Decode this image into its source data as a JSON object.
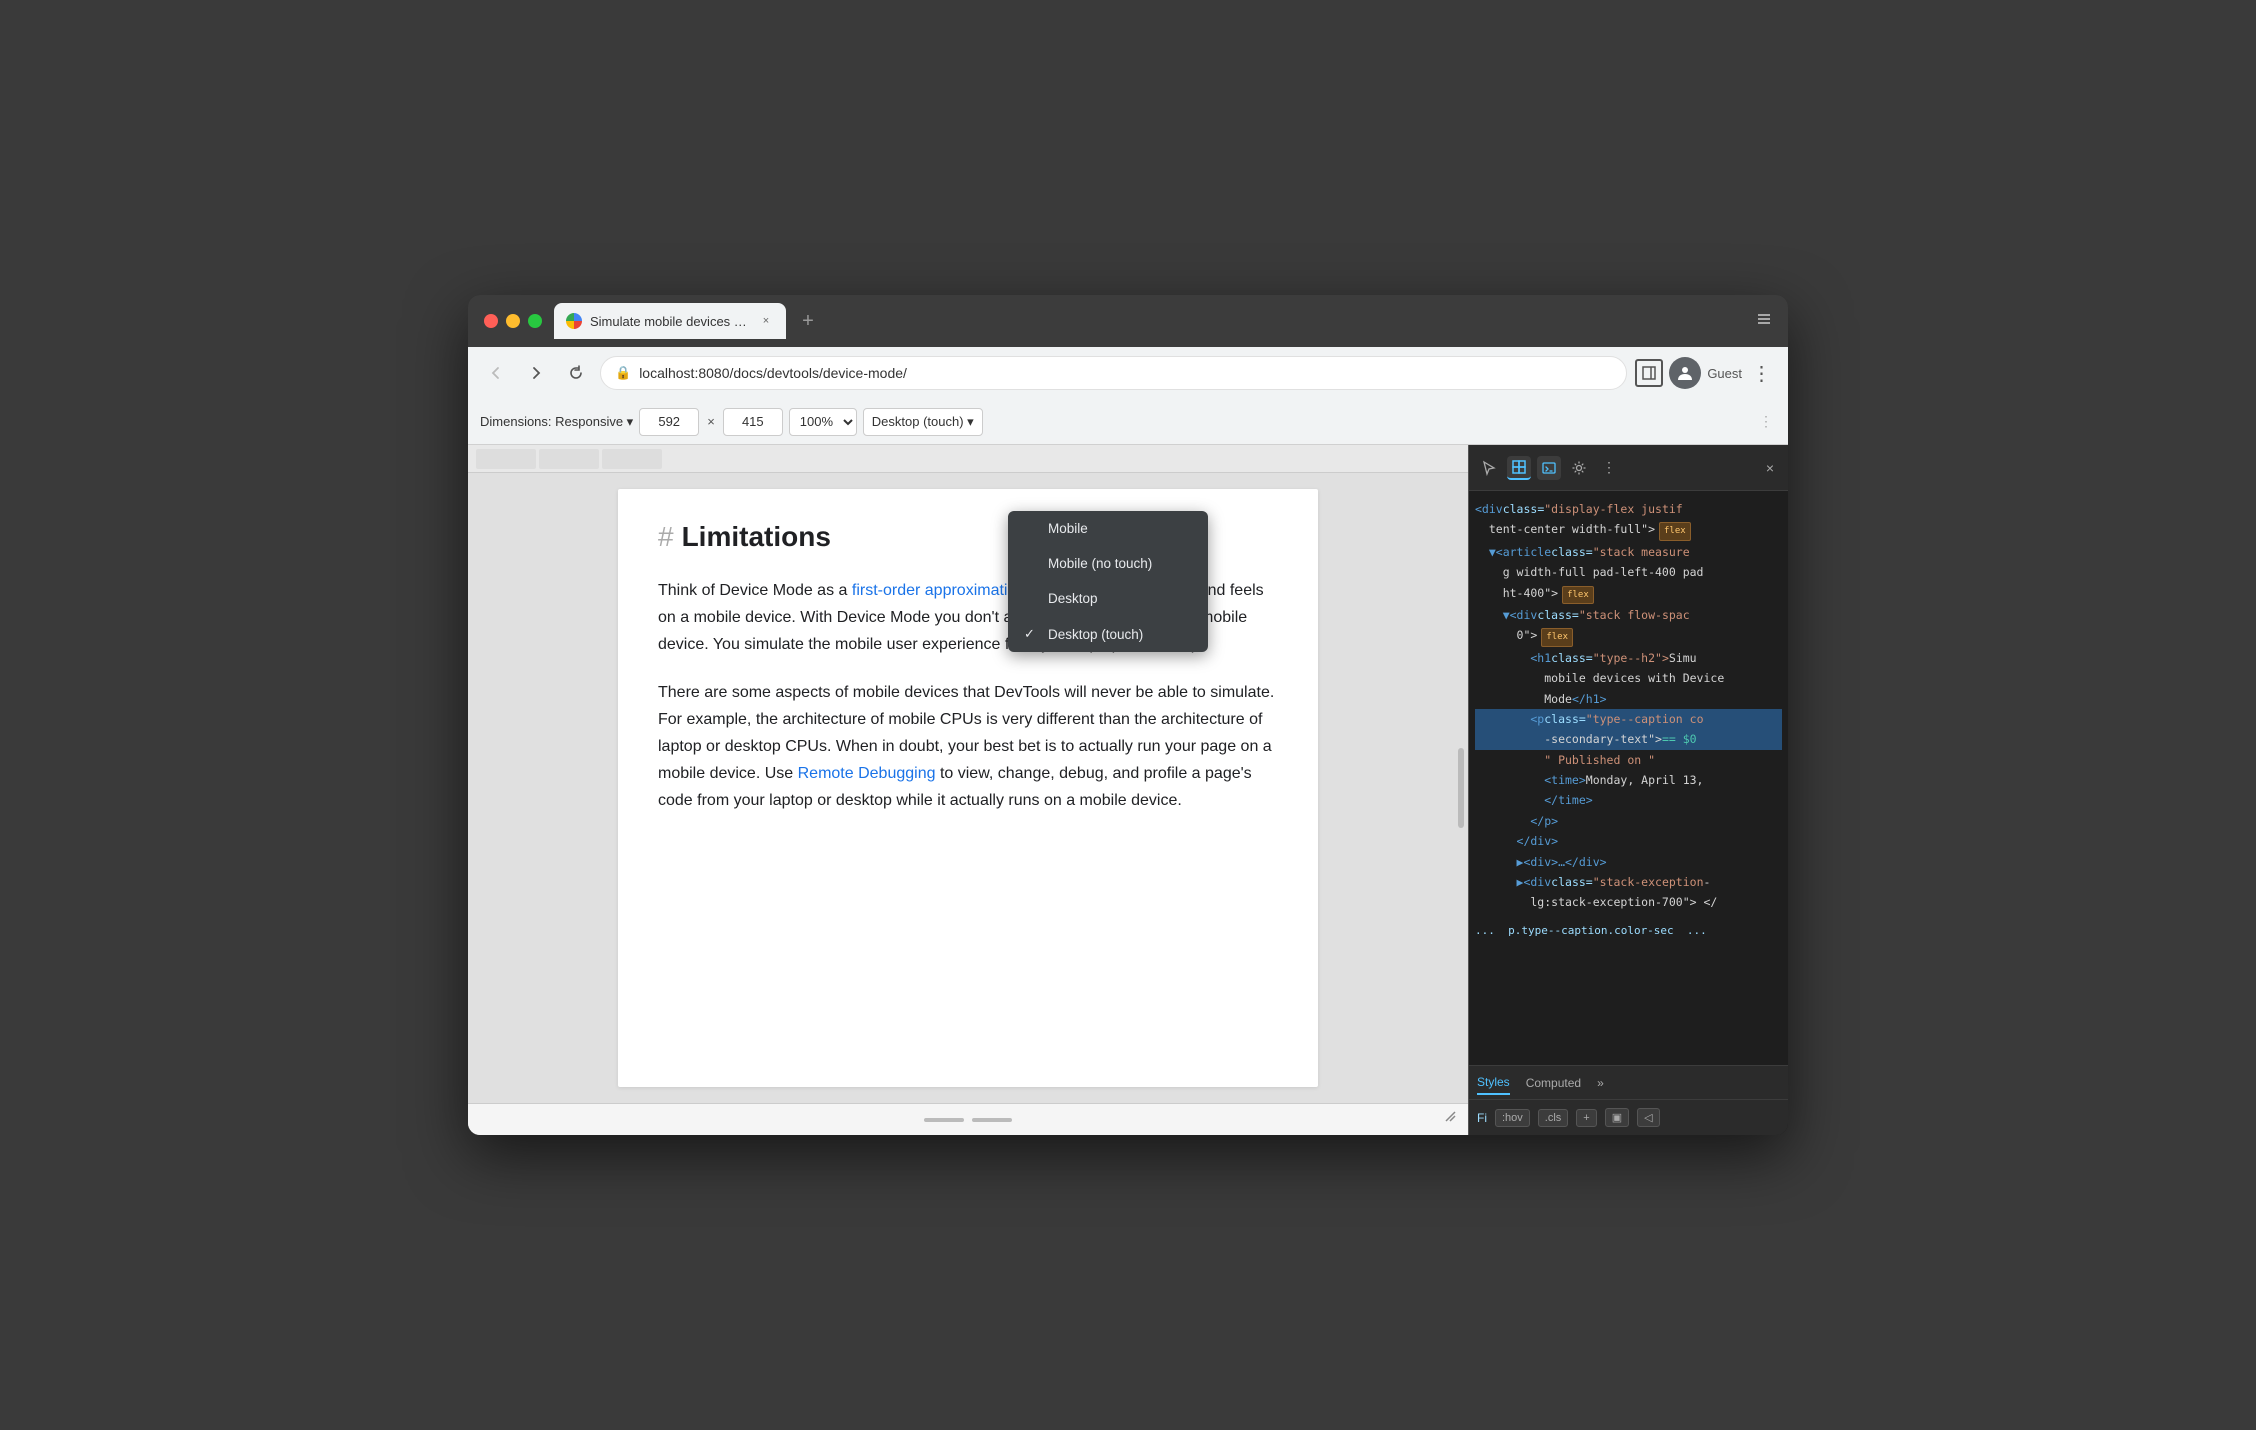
{
  "browser": {
    "tab_title": "Simulate mobile devices with D",
    "tab_favicon": "chrome-favicon",
    "new_tab_label": "+",
    "window_control_close": "×",
    "window_control_minimize": "−",
    "window_control_maximize": "+",
    "address": "localhost:8080/docs/devtools/device-mode/",
    "profile_label": "Guest",
    "chevron_down": "▾"
  },
  "devtools_bar": {
    "dimensions_label": "Dimensions: Responsive ▾",
    "width_value": "592",
    "height_value": "415",
    "x_separator": "×",
    "zoom_value": "100% ▾",
    "device_value": "Desktop (touch) ▾"
  },
  "page": {
    "hash": "#",
    "heading": "Limitations",
    "paragraph1_before_link": "Think of Device Mode as a ",
    "paragraph1_link": "first-order approximation",
    "paragraph1_after_link": " of how your page looks and feels on a mobile device. With Device Mode you don't actually run your code on a mobile device. You simulate the mobile user experience from your laptop or desktop.",
    "paragraph2_before_link": "There are some aspects of mobile devices that DevTools will never be able to simulate. For example, the architecture of mobile CPUs is very different than the architecture of laptop or desktop CPUs. When in doubt, your best bet is to actually run your page on a mobile device. Use ",
    "paragraph2_link": "Remote Debugging",
    "paragraph2_after_link": " to view, change, debug, and profile a page's code from your laptop or desktop while it actually runs on a mobile device."
  },
  "dropdown": {
    "items": [
      {
        "label": "Mobile",
        "selected": false
      },
      {
        "label": "Mobile (no touch)",
        "selected": false
      },
      {
        "label": "Desktop",
        "selected": false
      },
      {
        "label": "Desktop (touch)",
        "selected": true
      }
    ]
  },
  "devtools_panel": {
    "code_lines": [
      {
        "content": "<div class=\"display-flex justif",
        "type": "tag_open"
      },
      {
        "content": "tent-center width-full\">",
        "type": "tag_cont",
        "badge": "flex"
      },
      {
        "content": "<article class=\"stack measure",
        "type": "tag_open"
      },
      {
        "content": "g width-full pad-left-400 pad",
        "type": "tag_cont"
      },
      {
        "content": "ht-400\">",
        "type": "tag_cont",
        "badge": "flex"
      },
      {
        "content": "<div class=\"stack flow-spac",
        "type": "tag_open"
      },
      {
        "content": "0\">",
        "type": "tag_cont",
        "badge": "flex"
      },
      {
        "content": "<h1 class=\"type--h2\">Simu",
        "type": "tag_open"
      },
      {
        "content": "mobile devices with Device",
        "type": "text"
      },
      {
        "content": "Mode</h1>",
        "type": "tag_close"
      },
      {
        "content": "<p class=\"type--caption co",
        "type": "tag_open",
        "selected": true
      },
      {
        "content": "-secondary-text\"> == $0",
        "type": "tag_cont_selected"
      },
      {
        "content": "\" Published on \"",
        "type": "string"
      },
      {
        "content": "<time>Monday, April 13,",
        "type": "tag_open"
      },
      {
        "content": "</time>",
        "type": "tag_close"
      },
      {
        "content": "</p>",
        "type": "tag_close"
      },
      {
        "content": "</div>",
        "type": "tag_close"
      },
      {
        "content": "▶<div>…</div>",
        "type": "collapsed"
      },
      {
        "content": "▶<div class=\"stack-exception",
        "type": "collapsed"
      },
      {
        "content": "lg:stack-exception-700\"> </",
        "type": "tag_cont"
      },
      {
        "content": "...   p.type--caption.color-sec   ...",
        "type": "selector"
      }
    ],
    "bottom_tabs": [
      {
        "label": "Styles",
        "active": true
      },
      {
        "label": "Computed",
        "active": false
      }
    ],
    "footer": {
      "filter": "Fi",
      "hov": ":hov",
      "cls": ".cls",
      "plus": "+",
      "icon1": "▣",
      "icon2": "◁"
    }
  }
}
